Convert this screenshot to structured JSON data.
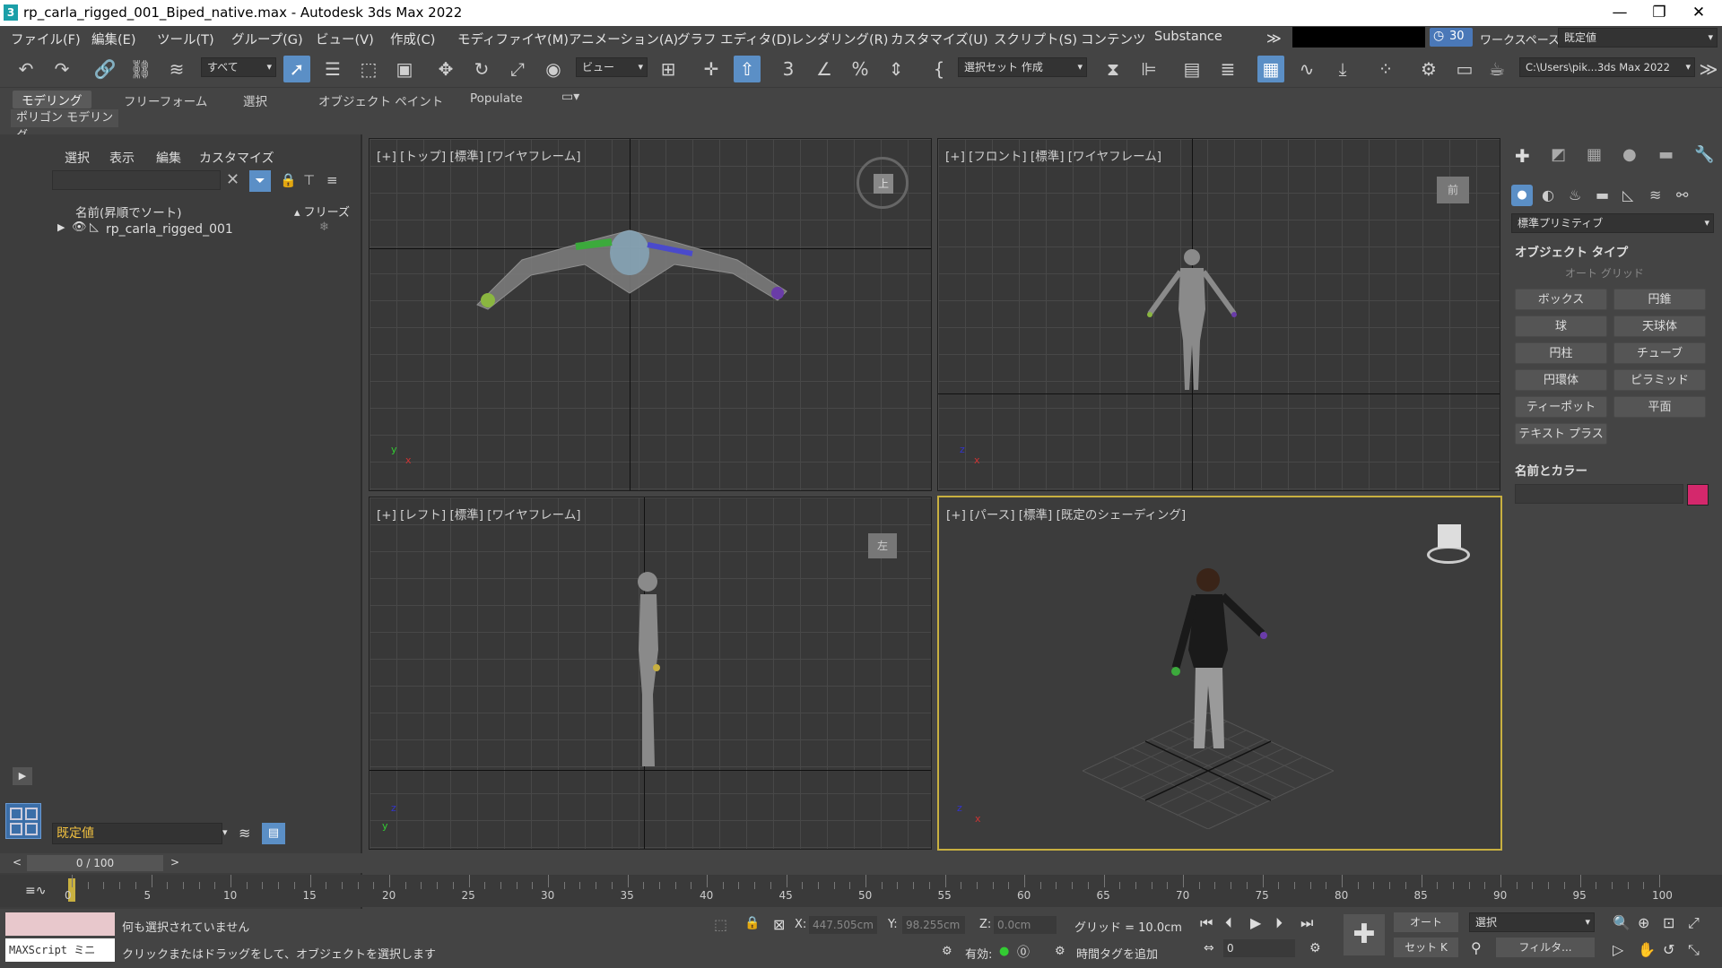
{
  "app": {
    "title": "rp_carla_rigged_001_Biped_native.max - Autodesk 3ds Max 2022",
    "logo": "3"
  },
  "menu": [
    "ファイル(F)",
    "編集(E)",
    "ツール(T)",
    "グループ(G)",
    "ビュー(V)",
    "作成(C)",
    "モディファイヤ(M)",
    "アニメーション(A)",
    "グラフ エディタ(D)",
    "レンダリング(R)",
    "カスタマイズ(U)",
    "スクリプト(S)",
    "コンテンツ",
    "Substance"
  ],
  "menu_more": "≫",
  "clock": "30",
  "workspace": {
    "label": "ワークスペース:",
    "value": "既定値"
  },
  "toolbar": {
    "filter": "すべて",
    "view": "ビュー",
    "selset": "選択セット 作成",
    "path": "C:\\Users\\pik...3ds Max 2022"
  },
  "ribbon": {
    "tabs": [
      "モデリング",
      "フリーフォーム",
      "選択",
      "オブジェクト ペイント",
      "Populate"
    ],
    "sub": "ポリゴン モデリング"
  },
  "scene": {
    "menu": [
      "選択",
      "表示",
      "編集",
      "カスタマイズ"
    ],
    "col_name": "名前(昇順でソート)",
    "col_freeze": "▴ フリーズ",
    "item": "rp_carla_rigged_001",
    "layer": "既定値"
  },
  "viewports": {
    "top": "[+] [トップ] [標準] [ワイヤフレーム]",
    "front": "[+] [フロント] [標準] [ワイヤフレーム]",
    "left": "[+] [レフト] [標準] [ワイヤフレーム]",
    "persp": "[+] [パース] [標準] [既定のシェーディング]",
    "cube_top": "上",
    "cube_front": "前",
    "cube_left": "左"
  },
  "cmd": {
    "dropdown": "標準プリミティブ",
    "rollout1": "オブジェクト タイプ",
    "autogrid": "オート グリッド",
    "buttons": [
      "ボックス",
      "円錐",
      "球",
      "天球体",
      "円柱",
      "チューブ",
      "円環体",
      "ピラミッド",
      "ティーポット",
      "平面",
      "テキスト プラス"
    ],
    "rollout2": "名前とカラー",
    "color": "#d4286c"
  },
  "timeline": {
    "frame": "0 / 100",
    "ticks": [
      "0",
      "5",
      "10",
      "15",
      "20",
      "25",
      "30",
      "35",
      "40",
      "45",
      "50",
      "55",
      "60",
      "65",
      "70",
      "75",
      "80",
      "85",
      "90",
      "95",
      "100"
    ]
  },
  "status": {
    "maxscript": "MAXScript ミニ",
    "msg1": "何も選択されていません",
    "msg2": "クリックまたはドラッグをして、オブジェクトを選択します",
    "x_label": "X:",
    "x": "447.505cm",
    "y_label": "Y:",
    "y": "98.255cm",
    "z_label": "Z:",
    "z": "0.0cm",
    "grid": "グリッド = 10.0cm",
    "enabled": "有効:",
    "addtag": "時間タグを追加",
    "auto": "オート",
    "setk": "セット K",
    "sel": "選択",
    "filter": "フィルタ...",
    "frame_field": "0"
  }
}
